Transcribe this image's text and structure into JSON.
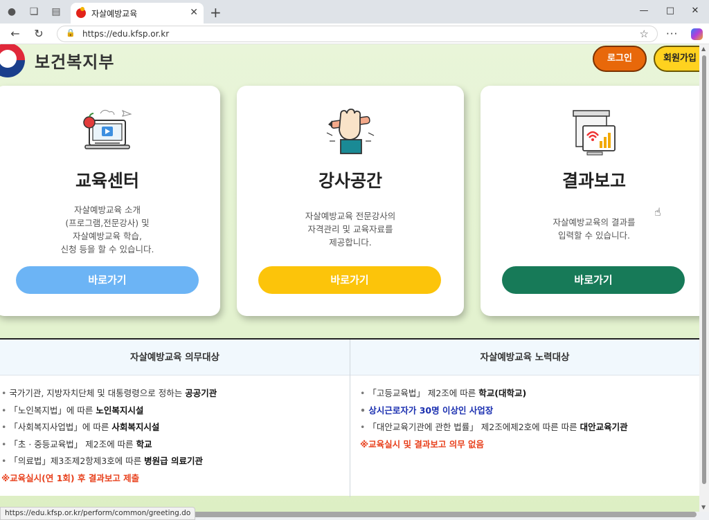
{
  "browser": {
    "tab_title": "자살예방교육",
    "url": "https://edu.kfsp.or.kr",
    "status_url": "https://edu.kfsp.or.kr/perform/common/greeting.do"
  },
  "header": {
    "logo_text": "보건복지부",
    "login_label": "로그인",
    "join_label": "회원가입"
  },
  "cards": [
    {
      "title": "교육센터",
      "desc": [
        "자살예방교육 소개",
        "(프로그램,전문강사) 및",
        "자살예방교육 학습,",
        "신청 등을 할 수 있습니다."
      ],
      "button": "바로가기",
      "color": "#6cb4f5",
      "icon": "elearning-laptop-icon"
    },
    {
      "title": "강사공간",
      "desc": [
        "자살예방교육 전문강사의",
        "자격관리 및 교육자료를",
        "제공합니다."
      ],
      "button": "바로가기",
      "color": "#fcc40a",
      "icon": "hand-pencil-icon"
    },
    {
      "title": "결과보고",
      "desc": [
        "자살예방교육의 결과를",
        "입력할 수 있습니다."
      ],
      "button": "바로가기",
      "color": "#177a58",
      "icon": "report-chart-icon"
    }
  ],
  "mandatory": {
    "title": "자살예방교육 의무대상",
    "items": [
      {
        "pre": "국가기관, 지방자치단체 및 대통령령으로 정하는 ",
        "bold": "공공기관"
      },
      {
        "pre": "「노인복지법」에 따른 ",
        "bold": "노인복지시설"
      },
      {
        "pre": "「사회복지사업법」에 따른 ",
        "bold": "사회복지시설"
      },
      {
        "pre": "「초 · 중등교육법」 제2조에 따른 ",
        "bold": "학교"
      },
      {
        "pre": "「의료법」제3조제2항제3호에 따른 ",
        "bold": "병원급 의료기관"
      }
    ],
    "note": "※교육실시(연 1회) 후 결과보고 제출"
  },
  "effort": {
    "title": "자살예방교육 노력대상",
    "items": [
      {
        "pre": "「고등교육법」 제2조에 따른 ",
        "bold": "학교(대학교)"
      },
      {
        "pre": "",
        "bold": "상시근로자가 30명 이상인 사업장"
      },
      {
        "pre": "「대안교육기관에 관한 법률」 제2조에제2호에 따른 따른 ",
        "bold": "대안교육기관"
      }
    ],
    "note": "※교육실시 및 결과보고 의무 없음"
  }
}
